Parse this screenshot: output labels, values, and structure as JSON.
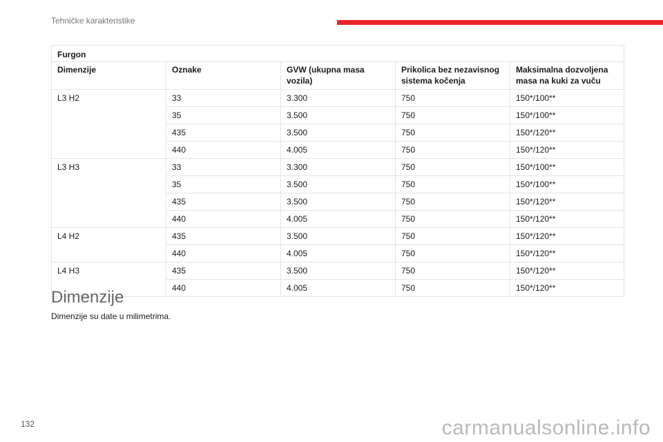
{
  "header": {
    "title": "Tehničke karakteristike",
    "accent_color": "#e8262c"
  },
  "table": {
    "caption": "Furgon",
    "columns": [
      "Dimenzije",
      "Oznake",
      "GVW (ukupna masa vozila)",
      "Prikolica bez nezavisnog sistema kočenja",
      "Maksimalna dozvoljena masa na kuki za vuču"
    ],
    "groups": [
      {
        "dimension": "L3 H2",
        "rows": [
          {
            "oznaka": "33",
            "gvw": "3.300",
            "prikolica": "750",
            "kuka": "150*/100**"
          },
          {
            "oznaka": "35",
            "gvw": "3.500",
            "prikolica": "750",
            "kuka": "150*/100**"
          },
          {
            "oznaka": "435",
            "gvw": "3.500",
            "prikolica": "750",
            "kuka": "150*/120**"
          },
          {
            "oznaka": "440",
            "gvw": "4.005",
            "prikolica": "750",
            "kuka": "150*/120**"
          }
        ]
      },
      {
        "dimension": "L3 H3",
        "rows": [
          {
            "oznaka": "33",
            "gvw": "3.300",
            "prikolica": "750",
            "kuka": "150*/100**"
          },
          {
            "oznaka": "35",
            "gvw": "3.500",
            "prikolica": "750",
            "kuka": "150*/100**"
          },
          {
            "oznaka": "435",
            "gvw": "3.500",
            "prikolica": "750",
            "kuka": "150*/120**"
          },
          {
            "oznaka": "440",
            "gvw": "4.005",
            "prikolica": "750",
            "kuka": "150*/120**"
          }
        ]
      },
      {
        "dimension": "L4 H2",
        "rows": [
          {
            "oznaka": "435",
            "gvw": "3.500",
            "prikolica": "750",
            "kuka": "150*/120**"
          },
          {
            "oznaka": "440",
            "gvw": "4.005",
            "prikolica": "750",
            "kuka": "150*/120**"
          }
        ]
      },
      {
        "dimension": "L4 H3",
        "rows": [
          {
            "oznaka": "435",
            "gvw": "3.500",
            "prikolica": "750",
            "kuka": "150*/120**"
          },
          {
            "oznaka": "440",
            "gvw": "4.005",
            "prikolica": "750",
            "kuka": "150*/120**"
          }
        ]
      }
    ]
  },
  "section": {
    "heading": "Dimenzije",
    "text": "Dimenzije su date u milimetrima."
  },
  "footer": {
    "page_number": "132",
    "watermark": "carmanualsonline.info"
  }
}
